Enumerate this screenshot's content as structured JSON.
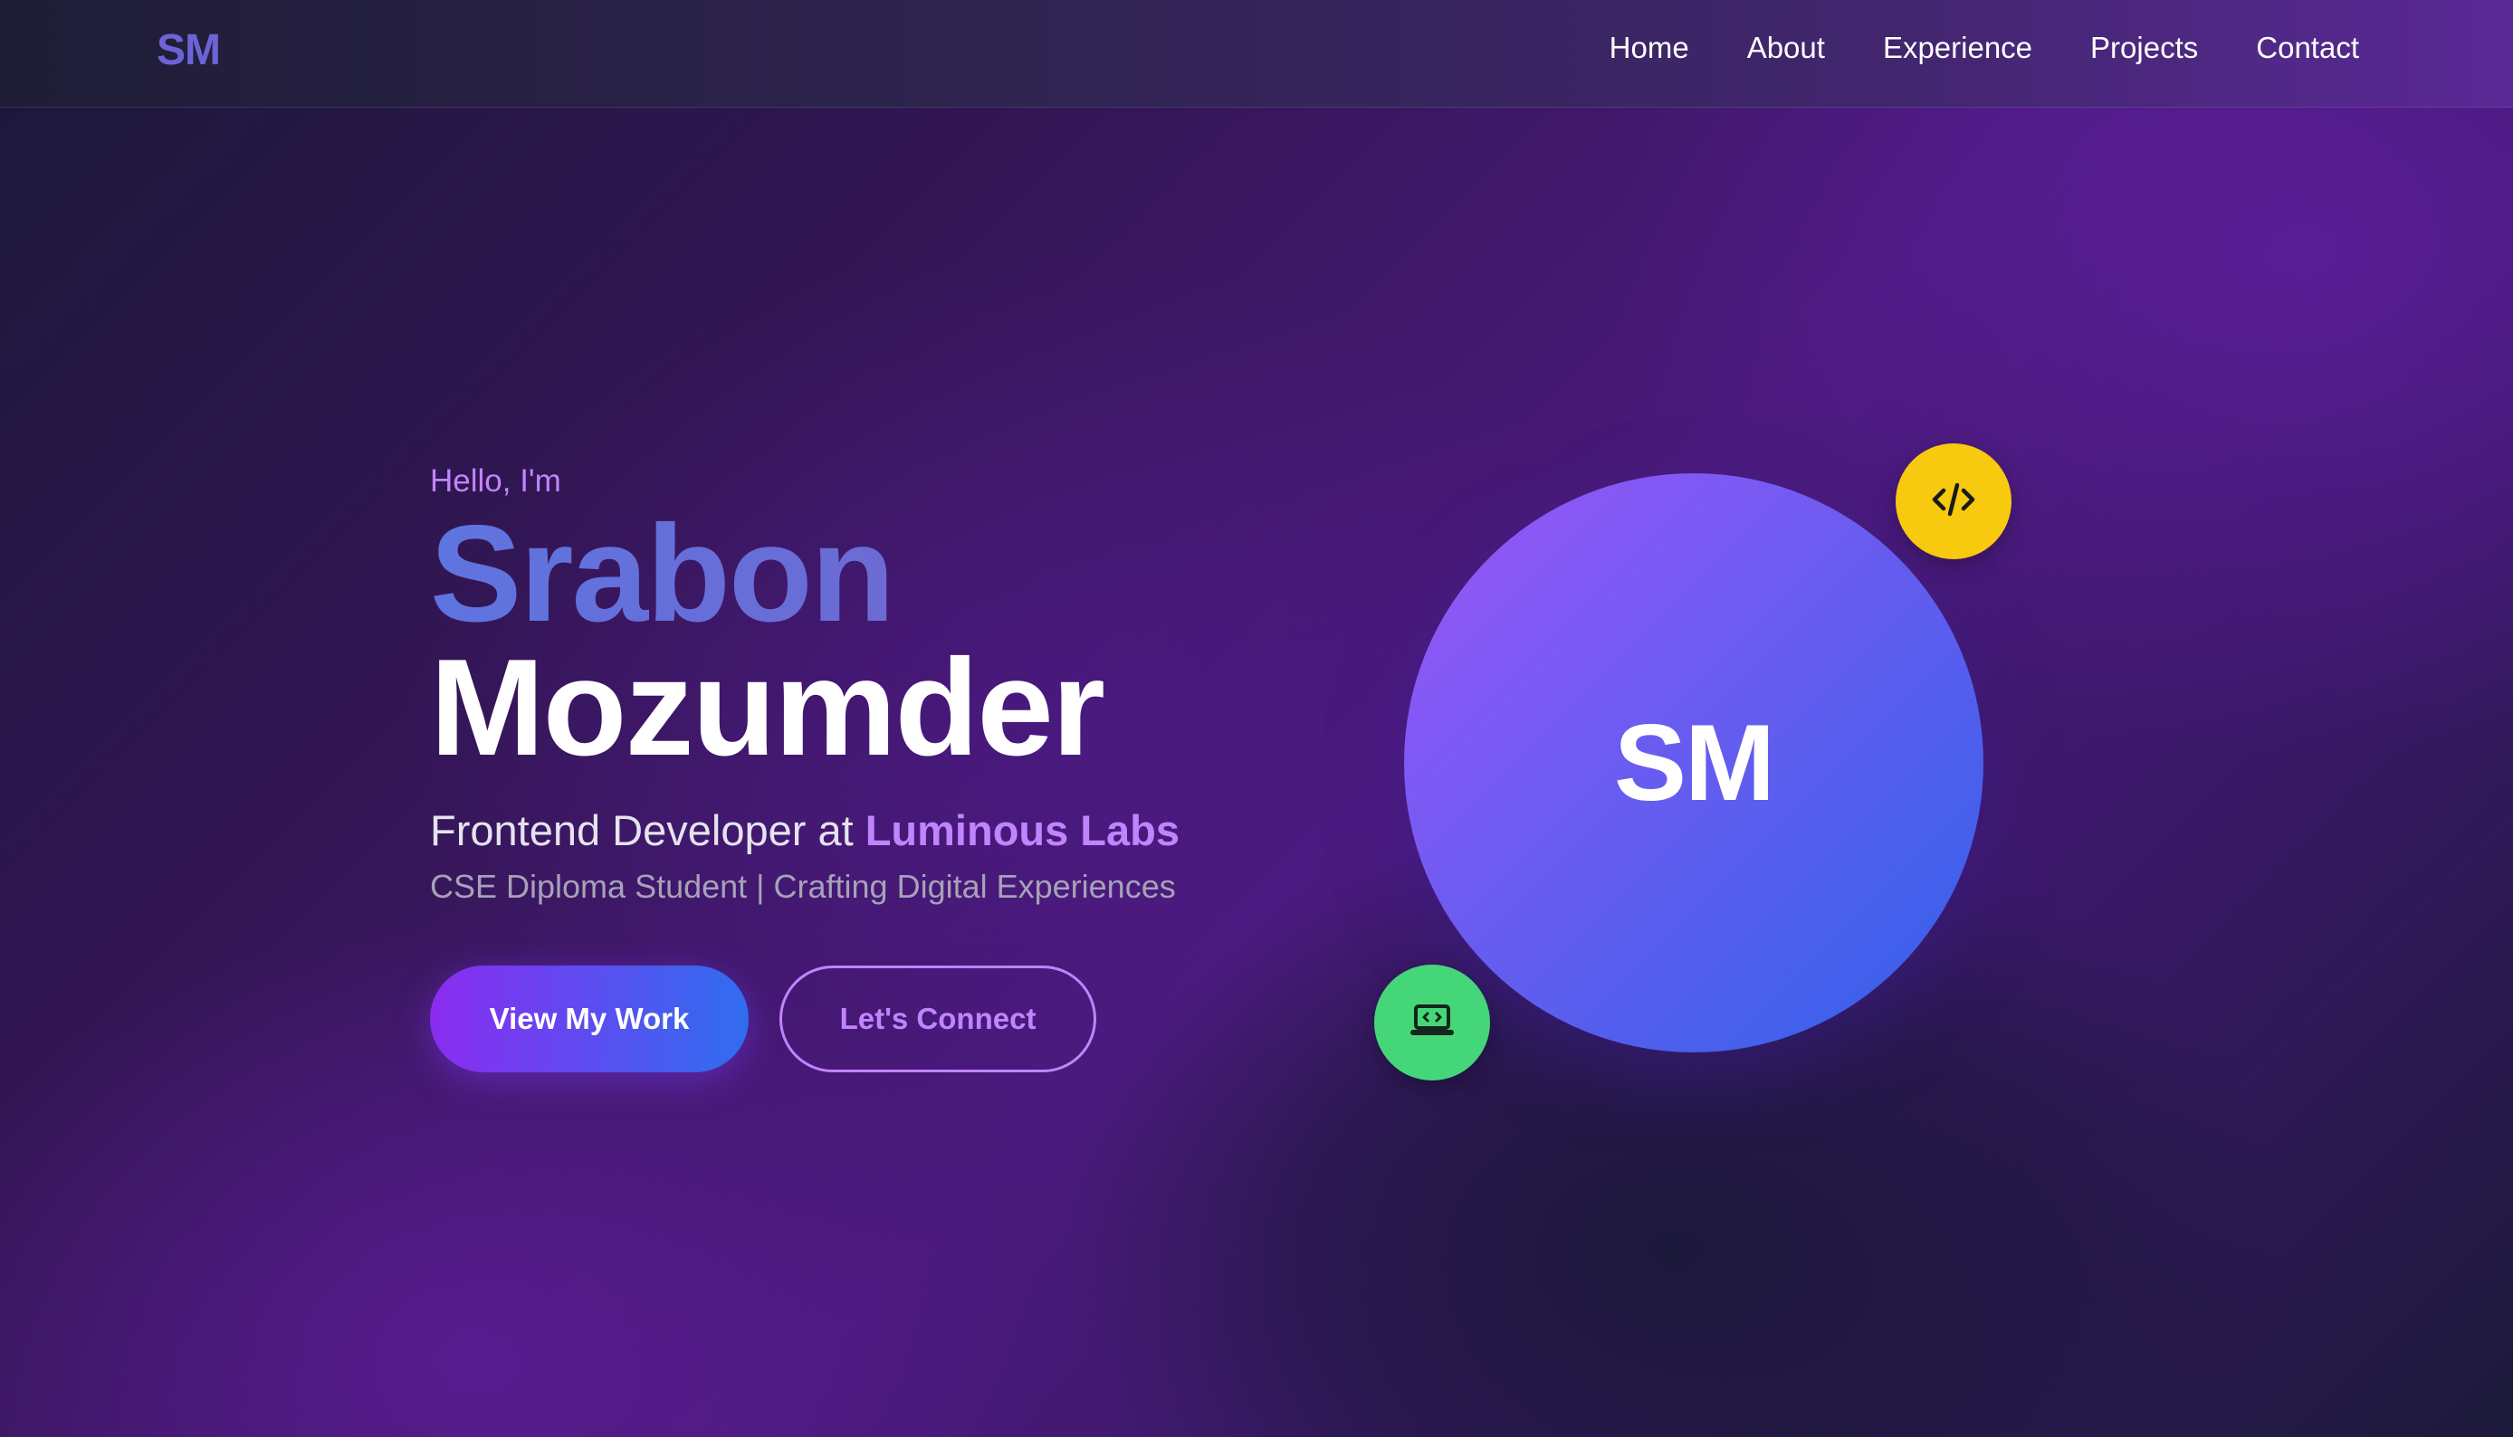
{
  "header": {
    "logo": "SM",
    "nav": [
      {
        "label": "Home"
      },
      {
        "label": "About"
      },
      {
        "label": "Experience"
      },
      {
        "label": "Projects"
      },
      {
        "label": "Contact"
      }
    ]
  },
  "hero": {
    "greeting": "Hello, I'm",
    "first_name": "Srabon",
    "last_name": "Mozumder",
    "role_prefix": "Frontend Developer at ",
    "company": "Luminous Labs",
    "tagline": "CSE Diploma Student | Crafting Digital Experiences",
    "primary_button": "View My Work",
    "secondary_button": "Let's Connect"
  },
  "avatar": {
    "initials": "SM",
    "badges": [
      {
        "icon": "code-icon",
        "color": "#f7c90f"
      },
      {
        "icon": "laptop-code-icon",
        "color": "#46d67a"
      }
    ]
  },
  "colors": {
    "accent": "#c084fc",
    "button_gradient_start": "#8b2cf0",
    "button_gradient_end": "#2f6df0",
    "avatar_gradient_start": "#9b55f8",
    "avatar_gradient_end": "#2f62ea"
  }
}
